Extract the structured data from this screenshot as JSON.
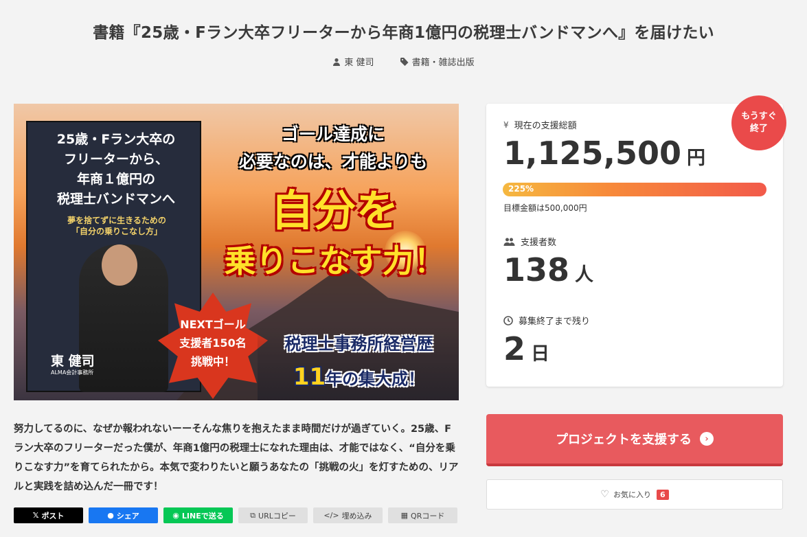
{
  "header": {
    "title": "書籍『25歳・Fラン大卒フリーターから年商1億円の税理士バンドマンへ』を届けたい",
    "author": "東 健司",
    "category": "書籍・雑誌出版"
  },
  "hero": {
    "cover_title": "25歳・Fラン大卒の\nフリーターから、\n年商１億円の\n税理士バンドマンへ",
    "cover_subtitle": "夢を捨てずに生きるための\n「自分の乗りこなし方」",
    "author_name": "東 健司",
    "author_org": "ALMA会計事務所",
    "headline": "ゴール達成に\n必要なのは、才能よりも",
    "big_line1": "自分を",
    "big_line2": "乗りこなす力！",
    "star_text": "NEXTゴール\n支援者150名\n挑戦中！",
    "banner_line1": "税理士事務所経営歴",
    "banner_num": "11",
    "banner_line2_rest": "年の集大成！"
  },
  "description": "努力してるのに、なぜか報われないーーそんな焦りを抱えたまま時間だけが過ぎていく。25歳、Fラン大卒のフリーターだった僕が、年商1億円の税理士になれた理由は、才能ではなく、“自分を乗りこなす力”を育てられたから。本気で変わりたいと願うあなたの「挑戦の火」を灯すための、リアルと実践を詰め込んだ一冊です！",
  "share": {
    "post": "ポスト",
    "share": "シェア",
    "line": "LINEで送る",
    "url_copy": "URLコピー",
    "embed": "埋め込み",
    "qr": "QRコード"
  },
  "stats": {
    "badge": "もうすぐ\n終了",
    "amount_label": "現在の支援総額",
    "amount_value": "1,125,500",
    "amount_unit": "円",
    "progress_text": "225%",
    "progress_percent": 225,
    "goal_text": "目標金額は500,000円",
    "supporters_label": "支援者数",
    "supporters_value": "138",
    "supporters_unit": "人",
    "remaining_label": "募集終了まで残り",
    "remaining_value": "2",
    "remaining_unit": "日"
  },
  "actions": {
    "support": "プロジェクトを支援する",
    "favorite": "お気に入り",
    "favorite_count": "6"
  },
  "colors": {
    "accent": "#e85a5e",
    "badge": "#ea4a4a",
    "x": "#000000",
    "facebook": "#1877f2",
    "line": "#06c755"
  }
}
